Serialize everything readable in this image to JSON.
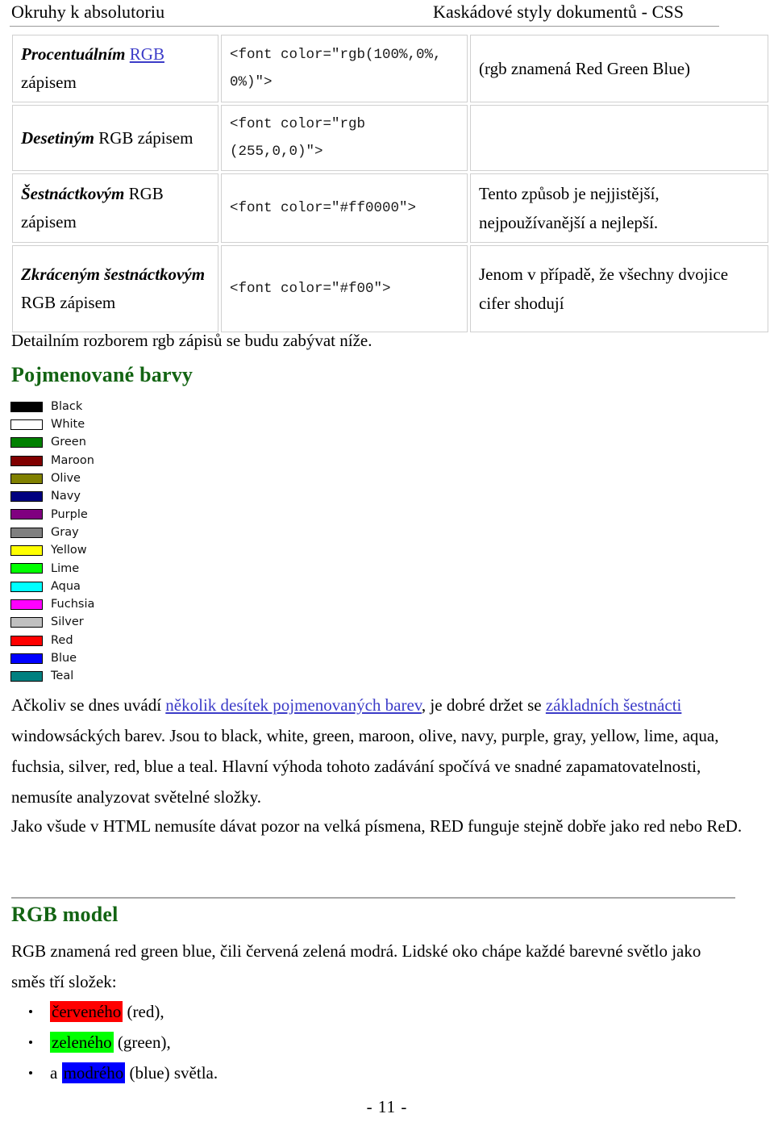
{
  "header": {
    "left_title": "Okruhy k absolutoriu",
    "right_title": "Kaskádové styly dokumentů - CSS"
  },
  "table": {
    "rows": [
      {
        "label_emph": "Procentuálním",
        "label_link": "RGB",
        "label_rest": "zápisem",
        "code": "<font color=\"rgb(100%,0%, 0%)\">",
        "note": "(rgb znamená Red Green Blue)"
      },
      {
        "label_emph": "Desetiným",
        "label_link": "",
        "label_rest": "RGB zápisem",
        "code": "<font color=\"rgb (255,0,0)\">",
        "note": ""
      },
      {
        "label_emph": "Šestnáctkovým",
        "label_link": "",
        "label_rest": "RGB zápisem",
        "code": "<font color=\"#ff0000\">",
        "note": "Tento způsob je nejjistější, nejpoužívanější a nejlepší."
      },
      {
        "label_emph": "Zkráceným šestnáctkovým",
        "label_link": "",
        "label_rest": "RGB zápisem",
        "code": "<font color=\"#f00\">",
        "note": "Jenom v případě, že všechny dvojice cifer shodují"
      }
    ]
  },
  "body": {
    "detail_line": "Detailním rozborem rgb zápisů  se budu zabývat níže.",
    "heading_named_colors": "Pojmenované barvy",
    "heading_rgb_model": "RGB model",
    "paragraph_ackoliv_1": "Ačkoliv se dnes uvádí ",
    "link_nekolik": "několik desítek pojmenovaných barev",
    "paragraph_ackoliv_2": ", je dobré držet se ",
    "link_zakladnich": "základních šestnácti",
    "paragraph_ackoliv_3": " windowsáckých barev. Jsou to black, white, green, maroon, olive, navy, purple, gray, yellow, lime, aqua, fuchsia, silver, red, blue a teal. Hlavní výhoda tohoto zadávání spočívá ve snadné zapamatovatelnosti, nemusíte analyzovat světelné složky.",
    "paragraph_jako": "Jako všude v HTML nemusíte dávat pozor na velká písmena, RED funguje stejně dobře jako red nebo ReD.",
    "paragraph_rgb_model": "RGB znamená red green blue, čili červená zelená modrá. Lidské oko chápe každé barevné světlo jako směs tří složek:"
  },
  "swatches": [
    {
      "name": "Black",
      "color": "#000000"
    },
    {
      "name": "White",
      "color": "#ffffff"
    },
    {
      "name": "Green",
      "color": "#008000"
    },
    {
      "name": "Maroon",
      "color": "#800000"
    },
    {
      "name": "Olive",
      "color": "#808000"
    },
    {
      "name": "Navy",
      "color": "#000080"
    },
    {
      "name": "Purple",
      "color": "#800080"
    },
    {
      "name": "Gray",
      "color": "#808080"
    },
    {
      "name": "Yellow",
      "color": "#ffff00"
    },
    {
      "name": "Lime",
      "color": "#00ff00"
    },
    {
      "name": "Aqua",
      "color": "#00ffff"
    },
    {
      "name": "Fuchsia",
      "color": "#ff00ff"
    },
    {
      "name": "Silver",
      "color": "#c0c0c0"
    },
    {
      "name": "Red",
      "color": "#ff0000"
    },
    {
      "name": "Blue",
      "color": "#0000ff"
    },
    {
      "name": "Teal",
      "color": "#008080"
    }
  ],
  "bullets": [
    {
      "prefix": "",
      "highlight": "červeného",
      "highlight_color": "#ff0000",
      "suffix": " (red),"
    },
    {
      "prefix": "",
      "highlight": "zeleného",
      "highlight_color": "#00ff00",
      "suffix": " (green),"
    },
    {
      "prefix": "a ",
      "highlight": "modrého",
      "highlight_color": "#0000ff",
      "suffix": " (blue) světla."
    }
  ],
  "footer": {
    "page_number": "- 11 -"
  },
  "colors": {
    "heading_green": "#136413",
    "link_blue": "#3c3cc8",
    "rule_gray": "#9b9b9b",
    "table_border": "#d0d0d0"
  }
}
